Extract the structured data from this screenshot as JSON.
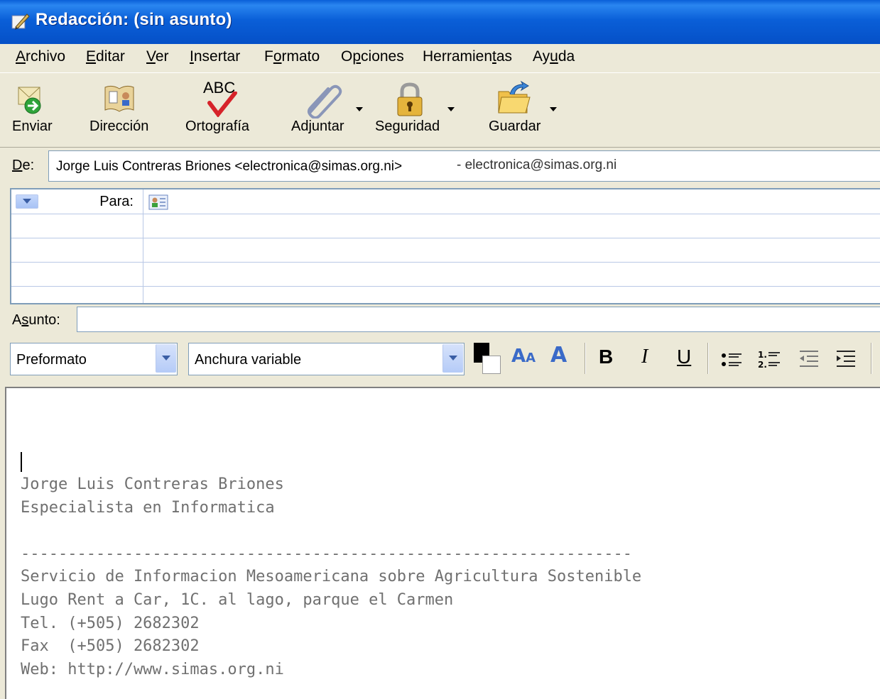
{
  "window": {
    "title": "Redacción: (sin asunto)"
  },
  "menu": [
    {
      "label_pre": "",
      "label_u": "A",
      "label_post": "rchivo"
    },
    {
      "label_pre": "",
      "label_u": "E",
      "label_post": "ditar"
    },
    {
      "label_pre": "",
      "label_u": "V",
      "label_post": "er"
    },
    {
      "label_pre": "",
      "label_u": "I",
      "label_post": "nsertar"
    },
    {
      "label_pre": "F",
      "label_u": "o",
      "label_post": "rmato"
    },
    {
      "label_pre": "O",
      "label_u": "p",
      "label_post": "ciones"
    },
    {
      "label_pre": "Herramien",
      "label_u": "t",
      "label_post": "as"
    },
    {
      "label_pre": "Ay",
      "label_u": "u",
      "label_post": "da"
    }
  ],
  "toolbar": {
    "send": "Enviar",
    "address": "Dirección",
    "spelling": "Ortografía",
    "attach": "Adjuntar",
    "security": "Seguridad",
    "save": "Guardar",
    "abc": "ABC"
  },
  "from": {
    "label": "De:",
    "name": "Jorge Luis Contreras Briones <electronica@simas.org.ni>",
    "account": "- electronica@simas.org.ni"
  },
  "recipients": {
    "type_label": "Para:"
  },
  "subject": {
    "label": "Asunto:",
    "value": ""
  },
  "format": {
    "paragraph": "Preformato",
    "font": "Anchura variable",
    "smaller": "A",
    "larger": "A",
    "bold": "B",
    "italic": "I",
    "underline": "U"
  },
  "signature": [
    "Jorge Luis Contreras Briones",
    "Especialista en Informatica",
    "",
    "-----------------------------------------------------------------",
    "Servicio de Informacion Mesoamericana sobre Agricultura Sostenible",
    "Lugo Rent a Car, 1C. al lago, parque el Carmen",
    "Tel. (+505) 2682302",
    "Fax  (+505) 2682302",
    "Web: http://www.simas.org.ni"
  ],
  "icons": {
    "title": "compose-icon",
    "send": "send-icon",
    "address": "address-book-icon",
    "spelling": "spellcheck-icon",
    "attach": "paperclip-icon",
    "security": "padlock-icon",
    "save": "folder-save-icon"
  },
  "colors": {
    "titlebar": "#0a5fd8",
    "chrome": "#ece9d8",
    "signature_text": "#707070"
  }
}
